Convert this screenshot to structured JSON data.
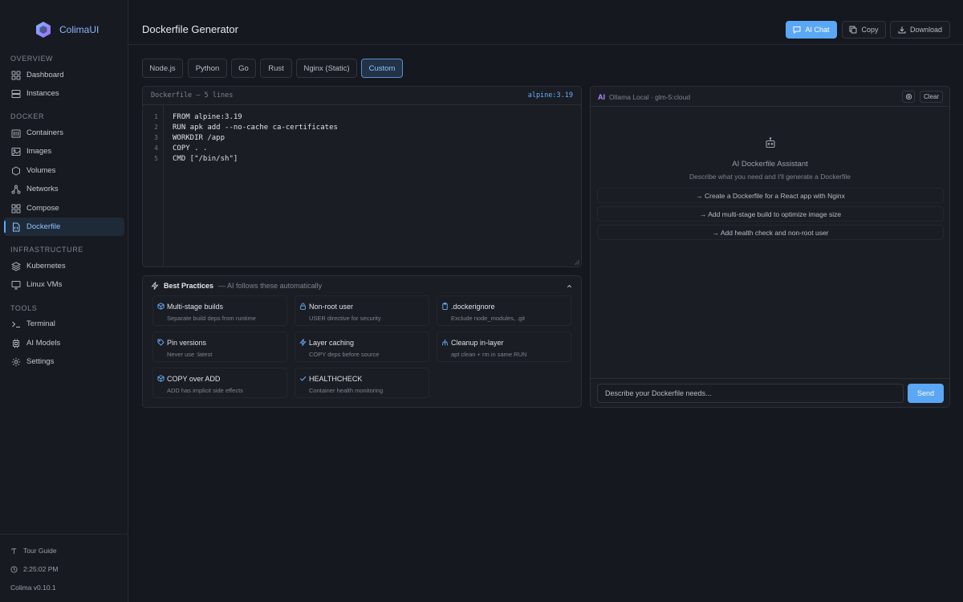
{
  "app": {
    "name": "ColimaUI"
  },
  "sidebar": {
    "sections": [
      {
        "label": "OVERVIEW",
        "items": [
          {
            "label": "Dashboard"
          },
          {
            "label": "Instances"
          }
        ]
      },
      {
        "label": "DOCKER",
        "items": [
          {
            "label": "Containers"
          },
          {
            "label": "Images"
          },
          {
            "label": "Volumes"
          },
          {
            "label": "Networks"
          },
          {
            "label": "Compose"
          },
          {
            "label": "Dockerfile"
          }
        ]
      },
      {
        "label": "INFRASTRUCTURE",
        "items": [
          {
            "label": "Kubernetes"
          },
          {
            "label": "Linux VMs"
          }
        ]
      },
      {
        "label": "TOOLS",
        "items": [
          {
            "label": "Terminal"
          },
          {
            "label": "AI Models"
          },
          {
            "label": "Settings"
          }
        ]
      }
    ],
    "active_item": "Dockerfile",
    "footer": {
      "tour": "Tour Guide",
      "time": "2:25:02 PM",
      "version": "Colima v0.10.1"
    }
  },
  "header": {
    "title": "Dockerfile Generator",
    "ai_chat_label": "AI Chat",
    "copy_label": "Copy",
    "download_label": "Download"
  },
  "templates": {
    "tabs": [
      "Node.js",
      "Python",
      "Go",
      "Rust",
      "Nginx (Static)",
      "Custom"
    ],
    "active": "Custom"
  },
  "editor": {
    "header": "Dockerfile — 5 lines",
    "base_tag": "alpine:3.19",
    "line_numbers": [
      "1",
      "2",
      "3",
      "4",
      "5"
    ],
    "lines": [
      "FROM alpine:3.19",
      "RUN apk add --no-cache ca-certificates",
      "WORKDIR /app",
      "COPY . .",
      "CMD [\"/bin/sh\"]"
    ]
  },
  "best_practices": {
    "title": "Best Practices",
    "subtitle": "— AI follows these automatically",
    "items": [
      {
        "title": "Multi-stage builds",
        "desc": "Separate build deps from runtime"
      },
      {
        "title": "Non-root user",
        "desc": "USER directive for security"
      },
      {
        "title": ".dockerignore",
        "desc": "Exclude node_modules, .git"
      },
      {
        "title": "Pin versions",
        "desc": "Never use :latest"
      },
      {
        "title": "Layer caching",
        "desc": "COPY deps before source"
      },
      {
        "title": "Cleanup in-layer",
        "desc": "apt clean + rm in same RUN"
      },
      {
        "title": "COPY over ADD",
        "desc": "ADD has implicit side effects"
      },
      {
        "title": "HEALTHCHECK",
        "desc": "Container health monitoring"
      }
    ]
  },
  "chat": {
    "badge": "AI",
    "model": "Ollama Local · glm-5:cloud",
    "clear_label": "Clear",
    "assistant_title": "AI Dockerfile Assistant",
    "assistant_desc": "Describe what you need and I'll generate a Dockerfile",
    "suggestions": [
      "→ Create a Dockerfile for a React app with Nginx",
      "→ Add multi-stage build to optimize image size",
      "→ Add health check and non-root user"
    ],
    "input_placeholder": "Describe your Dockerfile needs...",
    "send_label": "Send"
  },
  "colors": {
    "accent": "#5aa7f5",
    "active_nav": "#8fc4ff",
    "ai_badge": "#b38cff",
    "brand": "#8fb4ff"
  }
}
